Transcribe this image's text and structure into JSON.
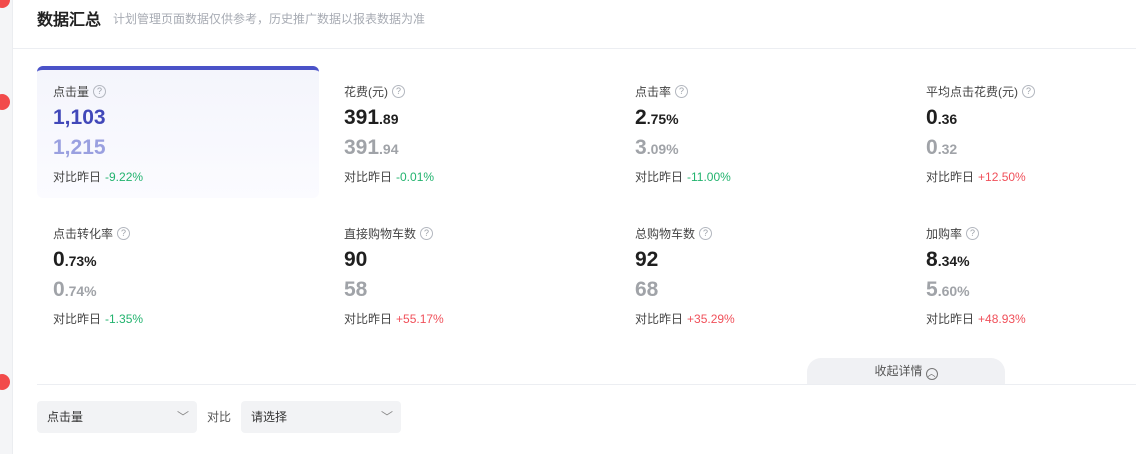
{
  "header": {
    "title": "数据汇总",
    "subtitle": "计划管理页面数据仅供参考，历史推广数据以报表数据为准"
  },
  "compare_label": "对比昨日",
  "metrics": [
    {
      "label": "点击量",
      "int": "1,103",
      "dec": "",
      "prev_int": "1,215",
      "prev_dec": "",
      "change": "-9.22%"
    },
    {
      "label": "花费(元)",
      "int": "391",
      "dec": ".89",
      "prev_int": "391",
      "prev_dec": ".94",
      "change": "-0.01%"
    },
    {
      "label": "点击率",
      "int": "2",
      "dec": ".75%",
      "prev_int": "3",
      "prev_dec": ".09%",
      "change": "-11.00%"
    },
    {
      "label": "平均点击花费(元)",
      "int": "0",
      "dec": ".36",
      "prev_int": "0",
      "prev_dec": ".32",
      "change": "+12.50%"
    },
    {
      "label": "点击转化率",
      "int": "0",
      "dec": ".73%",
      "prev_int": "0",
      "prev_dec": ".74%",
      "change": "-1.35%"
    },
    {
      "label": "直接购物车数",
      "int": "90",
      "dec": "",
      "prev_int": "58",
      "prev_dec": "",
      "change": "+55.17%"
    },
    {
      "label": "总购物车数",
      "int": "92",
      "dec": "",
      "prev_int": "68",
      "prev_dec": "",
      "change": "+35.29%"
    },
    {
      "label": "加购率",
      "int": "8",
      "dec": ".34%",
      "prev_int": "5",
      "prev_dec": ".60%",
      "change": "+48.93%"
    }
  ],
  "collapse_label": "收起详情",
  "filters": {
    "metric_select": "点击量",
    "vs_label": "对比",
    "compare_select": "请选择"
  },
  "colors": {
    "accent": "#4a52c8",
    "negative_change": "#22b36e",
    "positive_change": "#f0505a"
  }
}
